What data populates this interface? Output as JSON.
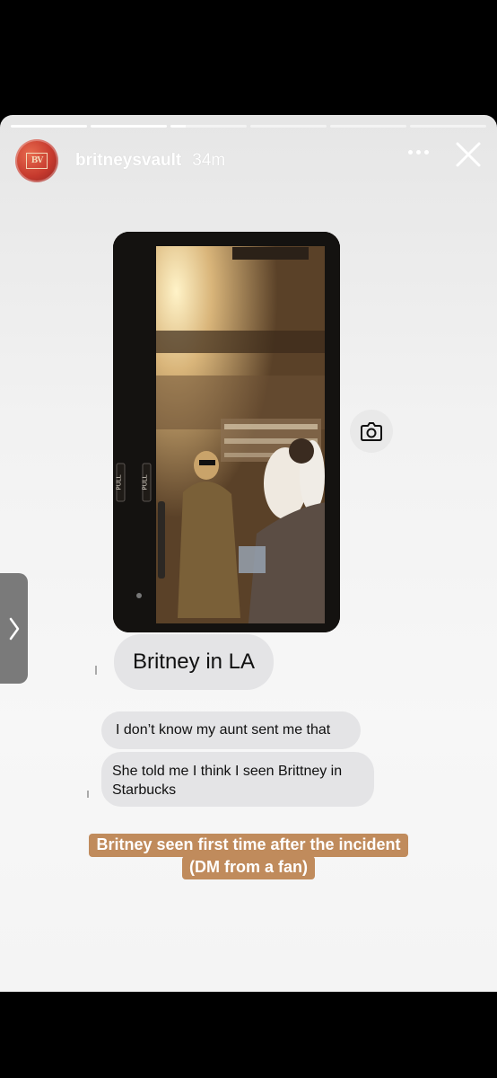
{
  "story": {
    "username": "britneysvault",
    "time": "34m",
    "progress_segments": 6,
    "current_segment": 3
  },
  "avatar": {
    "badge": "BV"
  },
  "photo": {
    "door_label_left": "PULL",
    "door_label_right": "PULL"
  },
  "messages": [
    {
      "text": "Britney in LA"
    },
    {
      "text": "I don’t know my aunt sent me that"
    },
    {
      "text_line1": "She told me I think I seen Brittney in",
      "text_line2": "Starbucks"
    }
  ],
  "caption": {
    "line1": "Britney seen first time after the incident",
    "line2": "(DM from a fan)"
  },
  "colors": {
    "caption_bg": "#c08b5c",
    "bubble_bg": "#e4e4e6"
  },
  "icons": [
    "more-icon",
    "close-icon",
    "camera-icon",
    "chevron-right-icon"
  ]
}
